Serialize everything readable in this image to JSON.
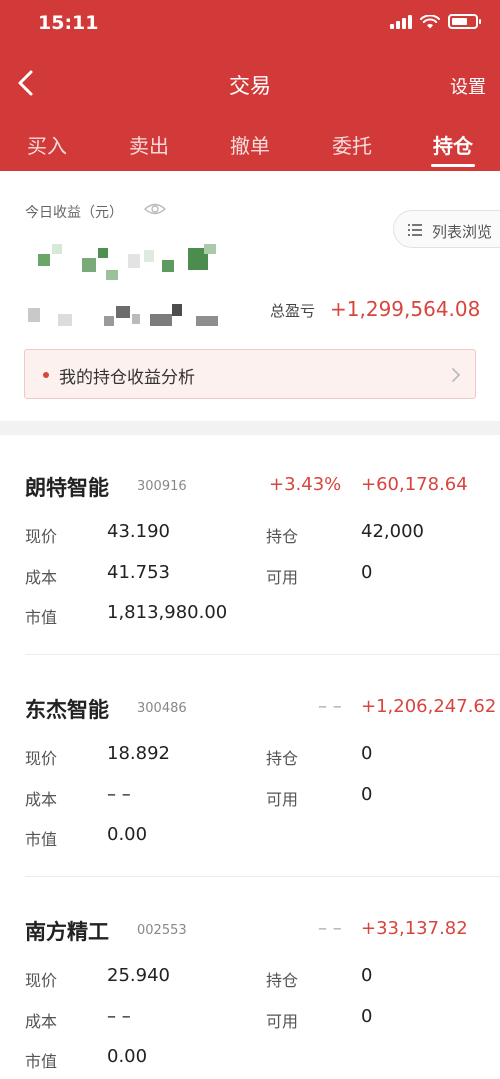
{
  "status_bar": {
    "time": "15:11"
  },
  "nav": {
    "title": "交易",
    "settings": "设置"
  },
  "tabs": [
    {
      "label": "买入",
      "active": false
    },
    {
      "label": "卖出",
      "active": false
    },
    {
      "label": "撤单",
      "active": false
    },
    {
      "label": "委托",
      "active": false
    },
    {
      "label": "持仓",
      "active": true
    }
  ],
  "summary": {
    "today_label": "今日收益（元）",
    "list_view_label": "列表浏览",
    "total_pl_label": "总盈亏",
    "total_pl_value": "+1,299,564.08",
    "analysis_label": "我的持仓收益分析"
  },
  "labels": {
    "price": "现价",
    "cost": "成本",
    "market_value": "市值",
    "position": "持仓",
    "available": "可用"
  },
  "holdings": [
    {
      "name": "朗特智能",
      "code": "300916",
      "pct": "+3.43%",
      "pl": "+60,178.64",
      "price": "43.190",
      "cost": "41.753",
      "market_value": "1,813,980.00",
      "position": "42,000",
      "available": "0"
    },
    {
      "name": "东杰智能",
      "code": "300486",
      "pct": "– –",
      "pl": "+1,206,247.62",
      "price": "18.892",
      "cost": "– –",
      "market_value": "0.00",
      "position": "0",
      "available": "0"
    },
    {
      "name": "南方精工",
      "code": "002553",
      "pct": "– –",
      "pl": "+33,137.82",
      "price": "25.940",
      "cost": "– –",
      "market_value": "0.00",
      "position": "0",
      "available": "0"
    }
  ],
  "colors": {
    "header_red": "#d23a3a",
    "profit_red": "#d8453f",
    "neutral_gray": "#aaaaaa"
  }
}
